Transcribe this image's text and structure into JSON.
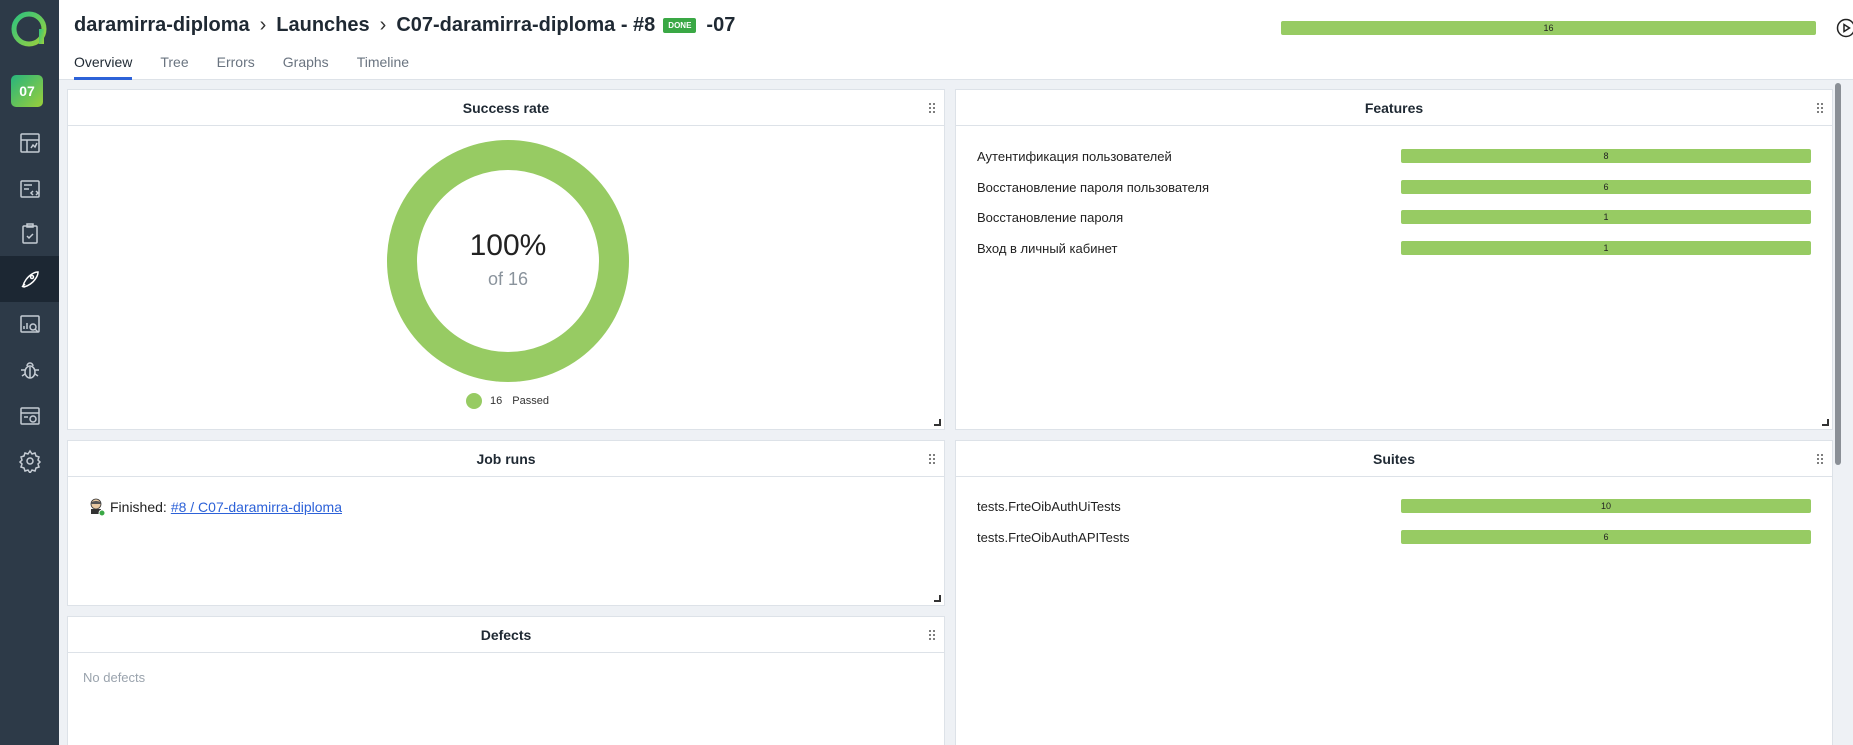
{
  "sidebar": {
    "project_badge": "07",
    "items": [
      {
        "icon": "dashboard-icon"
      },
      {
        "icon": "test-cases-icon"
      },
      {
        "icon": "test-plans-icon"
      },
      {
        "icon": "launches-icon",
        "active": true
      },
      {
        "icon": "analytics-icon"
      },
      {
        "icon": "defects-icon"
      },
      {
        "icon": "jobs-icon"
      },
      {
        "icon": "settings-icon"
      }
    ]
  },
  "header": {
    "breadcrumb": {
      "project": "daramirra-diploma",
      "section": "Launches",
      "launch": "C07-daramirra-diploma - #8",
      "status_badge": "DONE",
      "suffix": "-07"
    },
    "progress": {
      "value": 16,
      "passed_fraction": 1.0,
      "color": "#97cb63"
    },
    "tabs": [
      "Overview",
      "Tree",
      "Errors",
      "Graphs",
      "Timeline"
    ],
    "active_tab": "Overview"
  },
  "widgets": {
    "success_rate": {
      "title": "Success rate",
      "percent": "100%",
      "of_text": "of 16",
      "legend_count": "16",
      "legend_label": "Passed"
    },
    "features": {
      "title": "Features",
      "rows": [
        {
          "label": "Аутентификация пользователей",
          "count": "8"
        },
        {
          "label": "Восстановление пароля пользователя",
          "count": "6"
        },
        {
          "label": "Восстановление пароля",
          "count": "1"
        },
        {
          "label": "Вход в личный кабинет",
          "count": "1"
        }
      ]
    },
    "job_runs": {
      "title": "Job runs",
      "status_text": "Finished:",
      "link_text": "#8 / C07-daramirra-diploma"
    },
    "suites": {
      "title": "Suites",
      "rows": [
        {
          "label": "tests.FrteOibAuthUiTests",
          "count": "10"
        },
        {
          "label": "tests.FrteOibAuthAPITests",
          "count": "6"
        }
      ]
    },
    "defects": {
      "title": "Defects",
      "empty_text": "No defects"
    }
  },
  "colors": {
    "passed": "#97cb63",
    "accent": "#2d62d8",
    "sidebar": "#2d3a48"
  }
}
